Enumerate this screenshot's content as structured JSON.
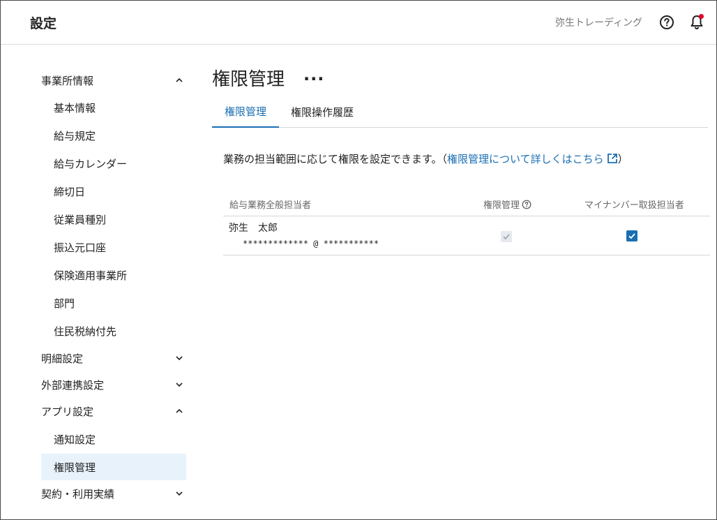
{
  "header": {
    "title": "設定",
    "company": "弥生トレーディング",
    "help_icon": "help-circle-icon",
    "bell_icon": "bell-icon",
    "notification_dot_color": "#e4002b"
  },
  "sidebar": {
    "items": [
      {
        "label": "事業所情報",
        "chevron": "up"
      },
      {
        "label": "基本情報"
      },
      {
        "label": "給与規定"
      },
      {
        "label": "給与カレンダー"
      },
      {
        "label": "締切日"
      },
      {
        "label": "従業員種別"
      },
      {
        "label": "振込元口座"
      },
      {
        "label": "保険適用事業所"
      },
      {
        "label": "部門"
      },
      {
        "label": "住民税納付先"
      },
      {
        "label": "明細設定",
        "chevron": "down"
      },
      {
        "label": "外部連携設定",
        "chevron": "down"
      },
      {
        "label": "アプリ設定",
        "chevron": "up"
      },
      {
        "label": "通知設定"
      },
      {
        "label": "権限管理",
        "active": true
      },
      {
        "label": "契約・利用実績",
        "chevron": "down"
      }
    ]
  },
  "main": {
    "title": "権限管理",
    "more_label": "...",
    "tabs": [
      {
        "label": "権限管理",
        "active": true
      },
      {
        "label": "権限操作履歴",
        "active": false
      }
    ],
    "description": {
      "text_before": "業務の担当範囲に応じて権限を設定できます。（",
      "link": "権限管理について詳しくはこちら",
      "text_after": "）"
    },
    "table": {
      "columns": [
        "給与業務全般担当者",
        "権限管理",
        "マイナンバー取扱担当者"
      ],
      "rows": [
        {
          "name": "弥生　太郎",
          "email": "************* @ ***********",
          "permission_admin": true,
          "permission_admin_disabled": true,
          "my_number": true
        }
      ]
    }
  },
  "colors": {
    "accent": "#1a6fb3",
    "active_bg": "#e8f2fb"
  }
}
